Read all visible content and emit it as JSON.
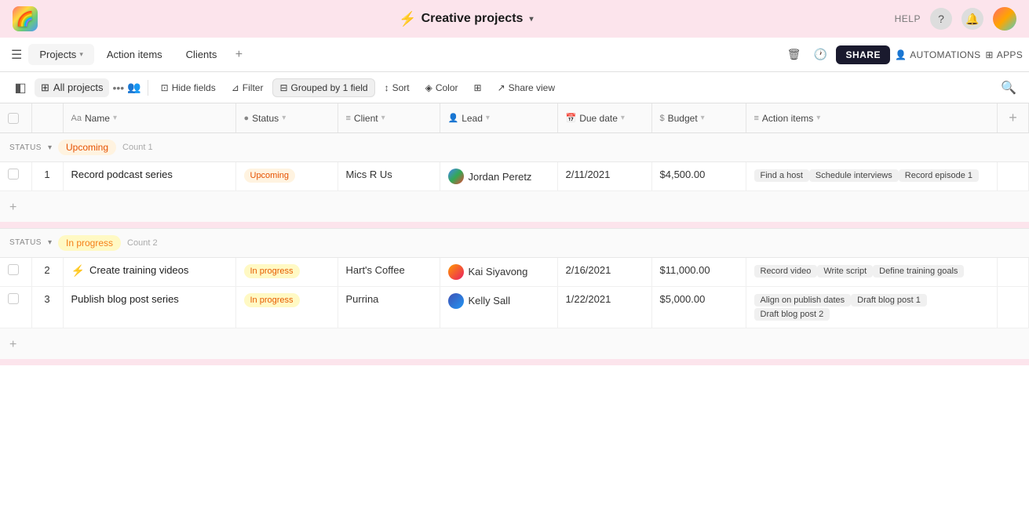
{
  "app": {
    "title": "Creative projects",
    "title_icon": "⚡",
    "dropdown_arrow": "▾"
  },
  "top_bar": {
    "help_label": "HELP",
    "automations_label": "AUTOMATIONS",
    "apps_label": "APPS",
    "share_label": "SHARE"
  },
  "tabs": [
    {
      "label": "Projects",
      "active": true,
      "has_dropdown": true
    },
    {
      "label": "Action items",
      "active": false
    },
    {
      "label": "Clients",
      "active": false
    }
  ],
  "toolbar": {
    "view_label": "All projects",
    "hide_fields_label": "Hide fields",
    "filter_label": "Filter",
    "grouped_label": "Grouped by 1 field",
    "sort_label": "Sort",
    "color_label": "Color",
    "share_view_label": "Share view"
  },
  "columns": [
    {
      "label": "Name",
      "icon": "Aa"
    },
    {
      "label": "Status",
      "icon": "●"
    },
    {
      "label": "Client",
      "icon": "≡"
    },
    {
      "label": "Lead",
      "icon": "👤"
    },
    {
      "label": "Due date",
      "icon": "📅"
    },
    {
      "label": "Budget",
      "icon": "$"
    },
    {
      "label": "Action items",
      "icon": "≡"
    }
  ],
  "groups": [
    {
      "status_label": "Upcoming",
      "status_class": "upcoming",
      "count_label": "Count",
      "count": "1",
      "rows": [
        {
          "num": "1",
          "name": "Record podcast series",
          "status": "Upcoming",
          "status_class": "upcoming",
          "client": "Mics R Us",
          "lead_name": "Jordan Peretz",
          "lead_avatar_class": "lead-avatar-jordan",
          "due_date": "2/11/2021",
          "budget": "$4,500.00",
          "action_items": [
            "Find a host",
            "Schedule interviews",
            "Record episode 1"
          ]
        }
      ]
    },
    {
      "status_label": "In progress",
      "status_class": "inprogress",
      "count_label": "Count",
      "count": "2",
      "rows": [
        {
          "num": "2",
          "name": "Create training videos",
          "status": "In progress",
          "status_class": "inprogress",
          "client": "Hart's Coffee",
          "lead_name": "Kai Siyavong",
          "lead_avatar_class": "lead-avatar-kai",
          "due_date": "2/16/2021",
          "budget": "$11,000.00",
          "action_items": [
            "Record video",
            "Write script",
            "Define training goals"
          ]
        },
        {
          "num": "3",
          "name": "Publish blog post series",
          "status": "In progress",
          "status_class": "inprogress",
          "client": "Purrina",
          "lead_name": "Kelly Sall",
          "lead_avatar_class": "lead-avatar-kelly",
          "due_date": "1/22/2021",
          "budget": "$5,000.00",
          "action_items": [
            "Align on publish dates",
            "Draft blog post 1",
            "Draft blog post 2"
          ]
        }
      ]
    }
  ]
}
